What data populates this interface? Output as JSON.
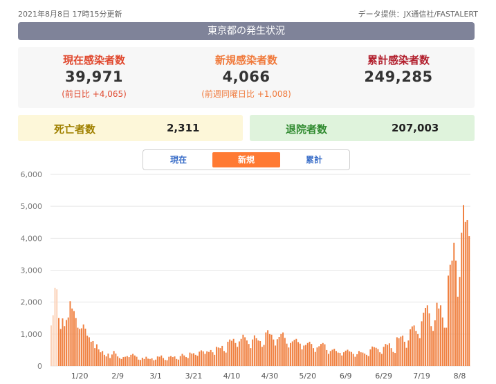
{
  "header": {
    "updated": "2021年8月8日 17時15分更新",
    "source": "データ提供：JX通信社/FASTALERT",
    "title": "東京都の発生状況"
  },
  "stats": {
    "current": {
      "label": "現在感染者数",
      "value": "39,971",
      "sub": "(前日比 +4,065)"
    },
    "new": {
      "label": "新規感染者数",
      "value": "4,066",
      "sub": "(前週同曜日比 +1,008)"
    },
    "total": {
      "label": "累計感染者数",
      "value": "249,285"
    }
  },
  "deaths": {
    "label": "死亡者数",
    "value": "2,311"
  },
  "recovered": {
    "label": "退院者数",
    "value": "207,003"
  },
  "tabs": [
    {
      "label": "現在",
      "active": false
    },
    {
      "label": "新規",
      "active": true
    },
    {
      "label": "累計",
      "active": false
    }
  ],
  "colors": {
    "bar": "#f08040",
    "bar_faded": "#fbd2b8",
    "tab_active": "#ff7a33",
    "title_bar": "#7f8399"
  },
  "chart_data": {
    "type": "bar",
    "ylim": [
      0,
      6000
    ],
    "yticks": [
      "0",
      "1,000",
      "2,000",
      "3,000",
      "4,000",
      "5,000",
      "6,000"
    ],
    "xticks": [
      "1/20",
      "2/9",
      "3/1",
      "3/21",
      "4/10",
      "4/30",
      "5/20",
      "6/9",
      "6/29",
      "7/19",
      "8/8"
    ],
    "start_date": "2021-01-05",
    "values": [
      1270,
      1590,
      2450,
      2400,
      1500,
      1160,
      1490,
      1250,
      1440,
      1520,
      2030,
      1800,
      1720,
      1500,
      1200,
      1160,
      1180,
      1300,
      1170,
      950,
      900,
      760,
      780,
      560,
      680,
      520,
      430,
      470,
      350,
      300,
      390,
      250,
      360,
      470,
      390,
      300,
      250,
      220,
      280,
      290,
      310,
      280,
      350,
      380,
      330,
      290,
      200,
      190,
      260,
      220,
      290,
      230,
      220,
      240,
      180,
      200,
      300,
      290,
      330,
      250,
      190,
      180,
      290,
      310,
      280,
      300,
      220,
      200,
      310,
      380,
      330,
      280,
      250,
      420,
      390,
      400,
      350,
      320,
      450,
      490,
      460,
      380,
      460,
      440,
      500,
      430,
      350,
      600,
      580,
      560,
      630,
      470,
      420,
      760,
      830,
      790,
      850,
      720,
      600,
      770,
      850,
      980,
      900,
      800,
      690,
      560,
      830,
      960,
      870,
      800,
      780,
      600,
      660,
      1050,
      1120,
      1000,
      980,
      830,
      640,
      840,
      910,
      1000,
      1050,
      880,
      700,
      580,
      720,
      770,
      820,
      850,
      750,
      700,
      520,
      640,
      660,
      720,
      760,
      690,
      560,
      440,
      580,
      620,
      690,
      720,
      680,
      500,
      380,
      470,
      510,
      540,
      470,
      420,
      410,
      330,
      430,
      480,
      510,
      460,
      440,
      380,
      290,
      370,
      470,
      430,
      420,
      390,
      350,
      310,
      520,
      610,
      590,
      570,
      530,
      430,
      380,
      600,
      690,
      660,
      710,
      560,
      440,
      410,
      900,
      870,
      920,
      950,
      760,
      570,
      800,
      1150,
      1240,
      1270,
      1100,
      1000,
      870,
      1400,
      1670,
      1820,
      1900,
      1650,
      1250,
      1100,
      1430,
      1980,
      1800,
      1900,
      1520,
      1200,
      1200,
      2830,
      3170,
      3300,
      3860,
      3300,
      2170,
      2790,
      4170,
      5040,
      4510,
      4570,
      4070
    ]
  }
}
